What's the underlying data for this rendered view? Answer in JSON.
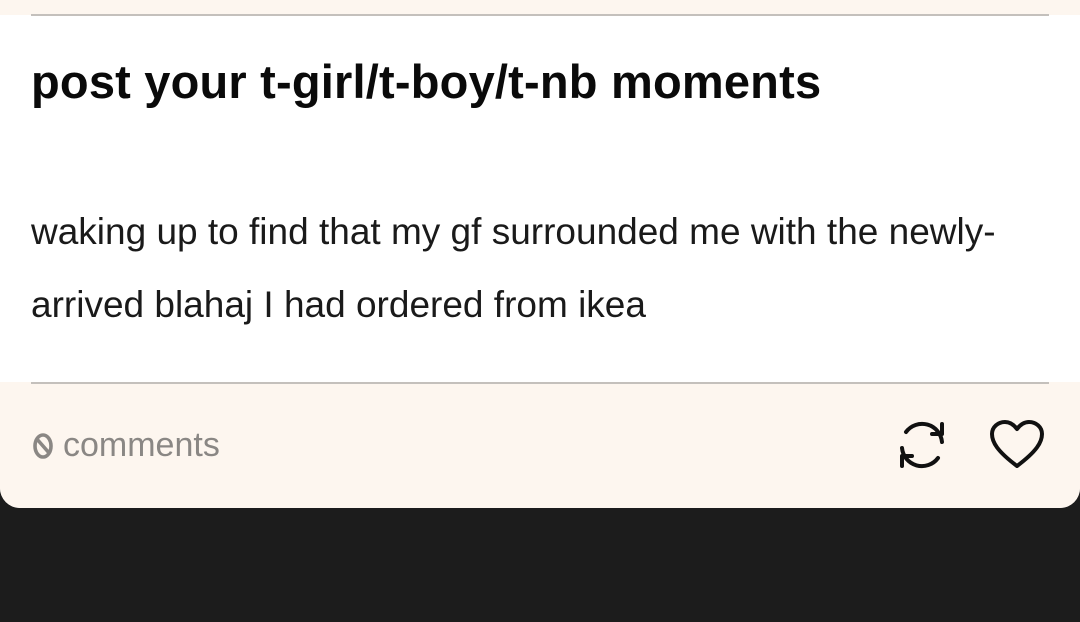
{
  "post": {
    "title": "post your t-girl/t-boy/t-nb moments",
    "body": "waking up to find that my gf surrounded me with the newly-arrived blahaj I had ordered from ikea"
  },
  "footer": {
    "comments_count": "0",
    "comments_label": "comments",
    "reblog_icon": "reblog-icon",
    "like_icon": "heart-icon"
  },
  "colors": {
    "page_background": "#1c1c1c",
    "card_background": "#ffffff",
    "footer_background": "#fdf6ef",
    "muted_text": "#8a8784",
    "divider": "#c4c0bc"
  }
}
